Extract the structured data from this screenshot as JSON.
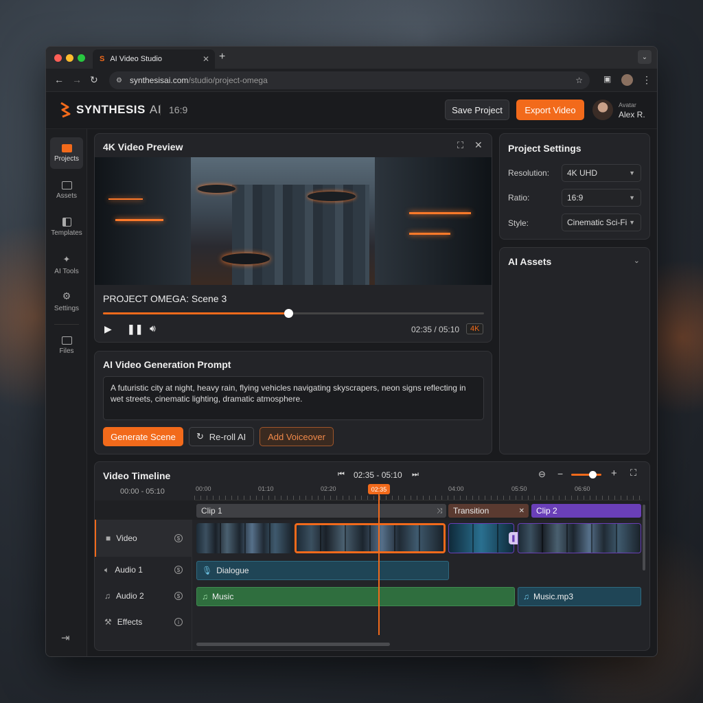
{
  "browser": {
    "tab_title": "AI Video Studio",
    "url_host": "synthesisai.com",
    "url_path": "/studio/project-omega"
  },
  "app": {
    "brand": "SYNTHESIS",
    "brand_suffix": "AI",
    "aspect": "16:9",
    "save_label": "Save Project",
    "export_label": "Export Video",
    "user_caption": "Avatar",
    "user_name": "Alex R."
  },
  "sidebar": {
    "items": [
      {
        "label": "Projects",
        "icon": "folder-filled-icon"
      },
      {
        "label": "Assets",
        "icon": "folder-icon"
      },
      {
        "label": "Templates",
        "icon": "layout-icon"
      },
      {
        "label": "AI Tools",
        "icon": "sparkle-icon"
      },
      {
        "label": "Settings",
        "icon": "gear-icon"
      },
      {
        "label": "Files",
        "icon": "folder-icon"
      }
    ]
  },
  "preview": {
    "title": "4K Video Preview",
    "scene_title": "PROJECT OMEGA: Scene 3",
    "time": "02:35 / 05:10",
    "badge": "4K",
    "progress": 0.5
  },
  "prompt": {
    "title": "AI Video Generation Prompt",
    "text": "A futuristic city at night, heavy rain, flying vehicles navigating skyscrapers, neon signs reflecting in wet streets, cinematic lighting, dramatic atmosphere.",
    "generate": "Generate Scene",
    "reroll": "Re-roll AI",
    "voiceover": "Add Voiceover"
  },
  "settings": {
    "title": "Project Settings",
    "rows": [
      {
        "label": "Resolution:",
        "value": "4K UHD"
      },
      {
        "label": "Ratio:",
        "value": "16:9"
      },
      {
        "label": "Style:",
        "value": "Cinematic Sci-Fi"
      }
    ]
  },
  "assets": {
    "title": "AI Assets"
  },
  "timeline": {
    "title": "Video Timeline",
    "range": "02:35 - 05:10",
    "time_range": "00:00 - 05:10",
    "playhead": "02:35",
    "ruler": [
      "00:00",
      "01:10",
      "02:20",
      "04:00",
      "05:50",
      "06:60"
    ],
    "clips": {
      "clip1": "Clip 1",
      "transition": "Transition",
      "clip2": "Clip 2"
    },
    "tracks": [
      {
        "label": "Video"
      },
      {
        "label": "Audio 1"
      },
      {
        "label": "Audio 2"
      },
      {
        "label": "Effects"
      }
    ],
    "audio": {
      "dialogue": "Dialogue",
      "music": "Music",
      "music_file": "Music.mp3"
    }
  },
  "colors": {
    "accent": "#f26a1b",
    "green": "#2f6e3e",
    "purple": "#6a3fb8",
    "teal": "#2a5468"
  }
}
